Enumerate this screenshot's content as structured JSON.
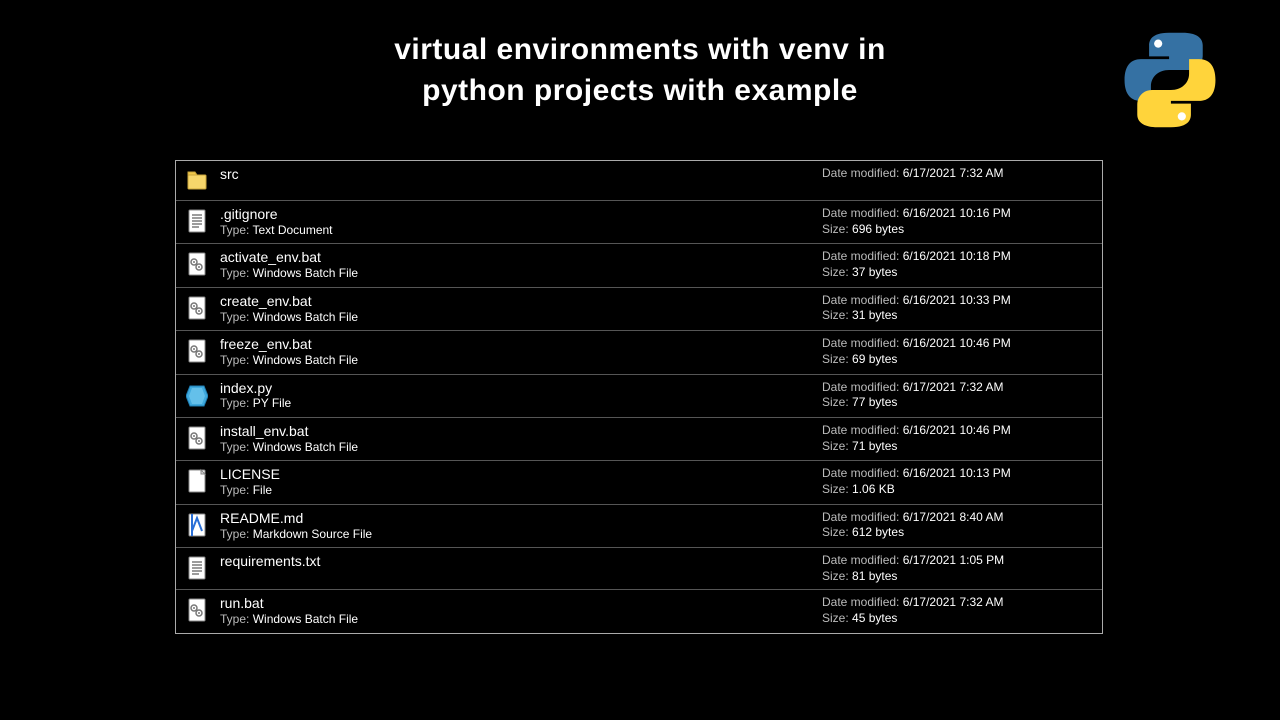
{
  "title_line1": "virtual environments with venv in",
  "title_line2": "python projects with example",
  "labels": {
    "type": "Type:",
    "date_modified": "Date modified:",
    "size": "Size:"
  },
  "files": [
    {
      "icon": "folder",
      "name": "src",
      "type": "",
      "date": "6/17/2021 7:32 AM",
      "size": ""
    },
    {
      "icon": "text",
      "name": ".gitignore",
      "type": "Text Document",
      "date": "6/16/2021 10:16 PM",
      "size": "696 bytes"
    },
    {
      "icon": "batch",
      "name": "activate_env.bat",
      "type": "Windows Batch File",
      "date": "6/16/2021 10:18 PM",
      "size": "37 bytes"
    },
    {
      "icon": "batch",
      "name": "create_env.bat",
      "type": "Windows Batch File",
      "date": "6/16/2021 10:33 PM",
      "size": "31 bytes"
    },
    {
      "icon": "batch",
      "name": "freeze_env.bat",
      "type": "Windows Batch File",
      "date": "6/16/2021 10:46 PM",
      "size": "69 bytes"
    },
    {
      "icon": "python",
      "name": "index.py",
      "type": "PY File",
      "date": "6/17/2021 7:32 AM",
      "size": "77 bytes"
    },
    {
      "icon": "batch",
      "name": "install_env.bat",
      "type": "Windows Batch File",
      "date": "6/16/2021 10:46 PM",
      "size": "71 bytes"
    },
    {
      "icon": "file",
      "name": "LICENSE",
      "type": "File",
      "date": "6/16/2021 10:13 PM",
      "size": "1.06 KB"
    },
    {
      "icon": "md",
      "name": "README.md",
      "type": "Markdown Source File",
      "date": "6/17/2021 8:40 AM",
      "size": "612 bytes"
    },
    {
      "icon": "text",
      "name": "requirements.txt",
      "type": "",
      "date": "6/17/2021 1:05 PM",
      "size": "81 bytes"
    },
    {
      "icon": "batch",
      "name": "run.bat",
      "type": "Windows Batch File",
      "date": "6/17/2021 7:32 AM",
      "size": "45 bytes"
    }
  ]
}
